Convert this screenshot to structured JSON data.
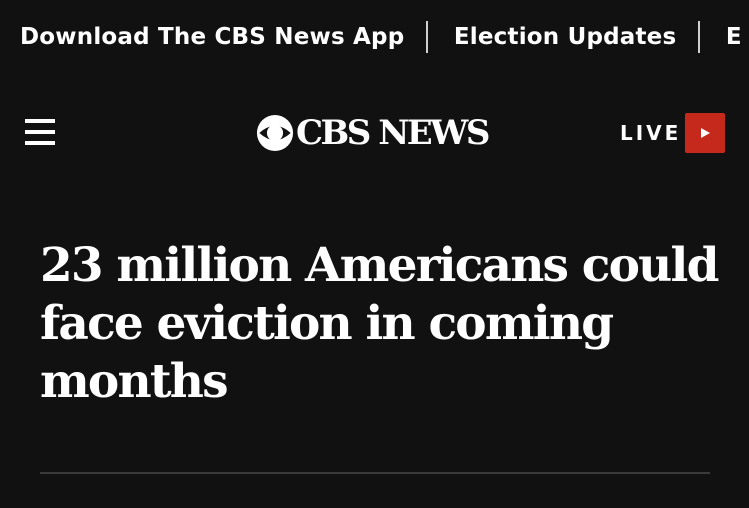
{
  "topbar": {
    "links": [
      {
        "label": "Download The CBS News App"
      },
      {
        "label": "Election Updates"
      },
      {
        "label": "E"
      }
    ]
  },
  "header": {
    "menu_icon": "hamburger-menu-icon",
    "logo_text": "CBS NEWS",
    "live_label": "LIVE",
    "live_icon": "play-icon",
    "live_color": "#c4291c"
  },
  "article": {
    "headline": "23 million Americans could face eviction in coming months"
  },
  "colors": {
    "background": "#111111",
    "text": "#ffffff",
    "accent": "#c4291c"
  }
}
